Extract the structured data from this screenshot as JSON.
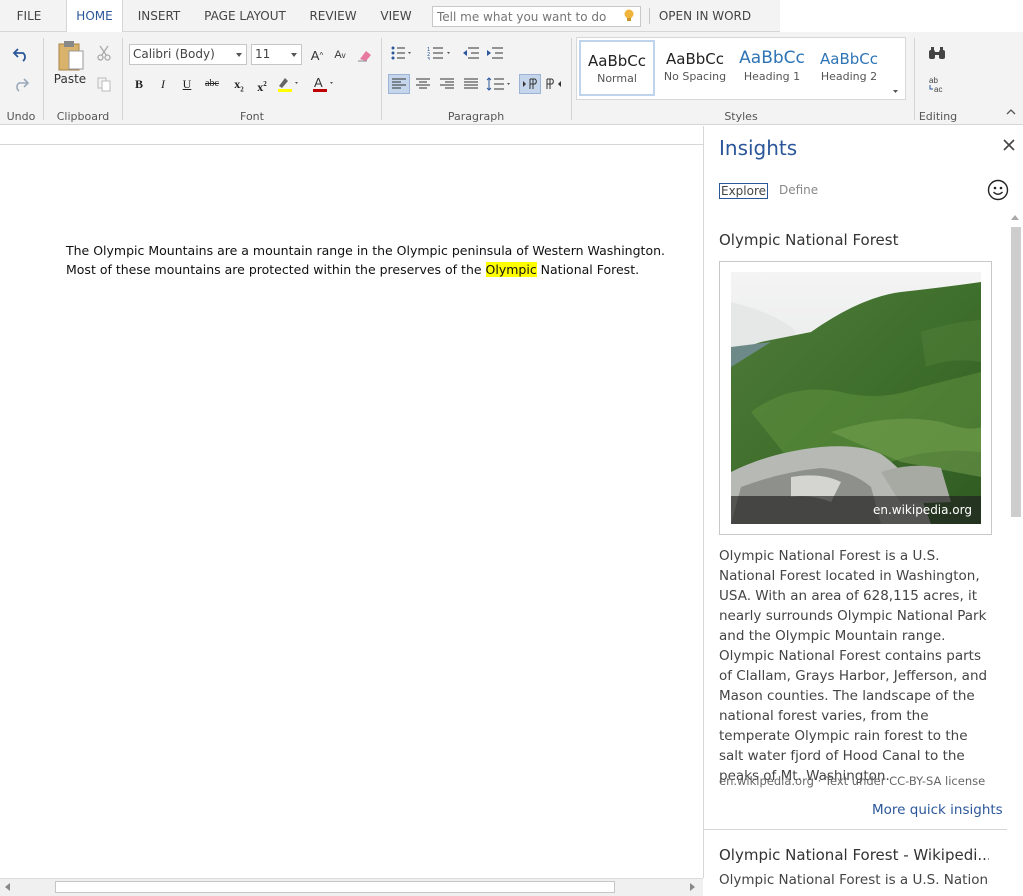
{
  "tabs": [
    {
      "label": "FILE",
      "active": false
    },
    {
      "label": "HOME",
      "active": true
    },
    {
      "label": "INSERT",
      "active": false
    },
    {
      "label": "PAGE LAYOUT",
      "active": false
    },
    {
      "label": "REVIEW",
      "active": false
    },
    {
      "label": "VIEW",
      "active": false
    }
  ],
  "tellme": {
    "placeholder": "Tell me what you want to do"
  },
  "open_in_word": "OPEN IN WORD",
  "ribbon": {
    "groups": {
      "undo": "Undo",
      "clipboard": "Clipboard",
      "font": "Font",
      "paragraph": "Paragraph",
      "styles": "Styles",
      "editing": "Editing"
    },
    "paste_label": "Paste",
    "font_name": "Calibri (Body)",
    "font_size": "11",
    "format_buttons": {
      "bold": "B",
      "italic": "I",
      "underline": "U",
      "strike": "abc",
      "sub": "x",
      "sup": "x"
    },
    "styles": [
      {
        "sample": "AaBbCc",
        "name": "Normal",
        "selected": true
      },
      {
        "sample": "AaBbCc",
        "name": "No Spacing",
        "selected": false
      },
      {
        "sample": "AaBbCc",
        "name": "Heading 1",
        "selected": false
      },
      {
        "sample": "AaBbCc",
        "name": "Heading 2",
        "selected": false
      }
    ],
    "colors": {
      "accent": "#2b579a",
      "highlight": "#ffff00",
      "font_color": "#c00000"
    }
  },
  "document": {
    "before": "The Olympic Mountains are a mountain range in the Olympic peninsula of Western Washington. Most of these mountains are protected within the preserves of the ",
    "highlight": "Olympic",
    "after": " National Forest."
  },
  "insights": {
    "title": "Insights",
    "tabs": {
      "explore": "Explore",
      "define": "Define"
    },
    "card1": {
      "title": "Olympic National Forest",
      "image_caption": "en.wikipedia.org",
      "description": "Olympic National Forest is a U.S. National Forest located in Washington, USA. With an area of 628,115 acres, it nearly surrounds Olympic National Park and the Olympic Mountain range. Olympic National Forest contains parts of Clallam, Grays Harbor, Jefferson, and Mason counties. The landscape of the national forest varies, from the temperate Olympic rain forest to the salt water fjord of Hood Canal to the peaks of Mt. Washington.",
      "source": "en.wikipedia.org · Text under CC-BY-SA license",
      "more_link": "More quick insights"
    },
    "card2": {
      "title": "Olympic National Forest - Wikipedi...",
      "text": "Olympic National Forest is a U.S. National"
    }
  }
}
